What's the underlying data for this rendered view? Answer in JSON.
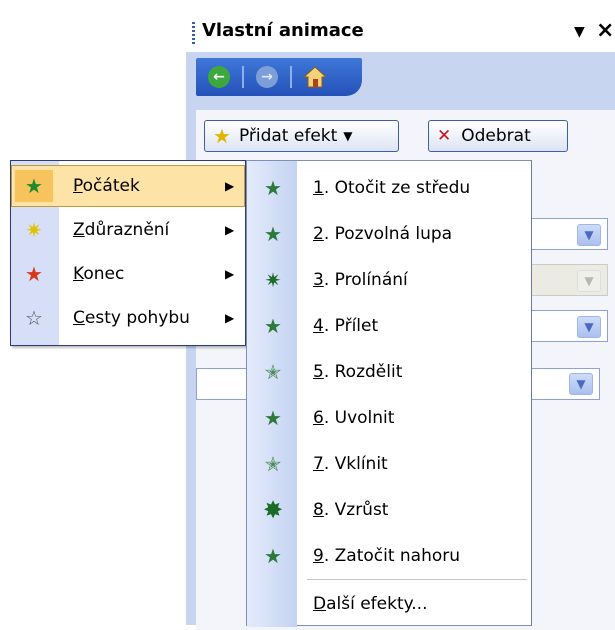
{
  "pane": {
    "title": "Vlastní animace",
    "dropdown_glyph": "▼",
    "close_glyph": "×",
    "nav": {
      "back_icon": "back-arrow-icon",
      "forward_icon": "forward-arrow-icon",
      "home_icon": "home-icon"
    },
    "add_effect_label": "Přidat efekt",
    "remove_label": "Odebrat",
    "arrow_glyph": "▼"
  },
  "main_menu": {
    "items": [
      {
        "prefix": "",
        "accel": "P",
        "rest": "očátek",
        "icon": "entrance-star-icon"
      },
      {
        "prefix": "",
        "accel": "Z",
        "rest": "důraznění",
        "icon": "emphasis-star-icon"
      },
      {
        "prefix": "",
        "accel": "K",
        "rest": "onec",
        "icon": "exit-star-icon"
      },
      {
        "prefix": "",
        "accel": "C",
        "rest": "esty pohybu",
        "icon": "motion-path-star-icon"
      }
    ],
    "submenu_arrow": "▶"
  },
  "sub_menu": {
    "items": [
      {
        "accel": "1",
        "rest": ". Otočit ze středu"
      },
      {
        "accel": "2",
        "rest": ". Pozvolná lupa"
      },
      {
        "accel": "3",
        "rest": ". Prolínání"
      },
      {
        "accel": "4",
        "rest": ". Přílet"
      },
      {
        "accel": "5",
        "rest": ". Rozdělit"
      },
      {
        "accel": "6",
        "rest": ". Uvolnit"
      },
      {
        "accel": "7",
        "rest": ". Vklínit"
      },
      {
        "accel": "8",
        "rest": ". Vzrůst"
      },
      {
        "accel": "9",
        "rest": ". Zatočit nahoru"
      }
    ],
    "more_accel": "D",
    "more_rest": "alší efekty..."
  },
  "colors": {
    "menu_highlight": "#fde3a6",
    "pane_background": "#c7d5f1",
    "nav_toolbar": "#2451b8"
  }
}
